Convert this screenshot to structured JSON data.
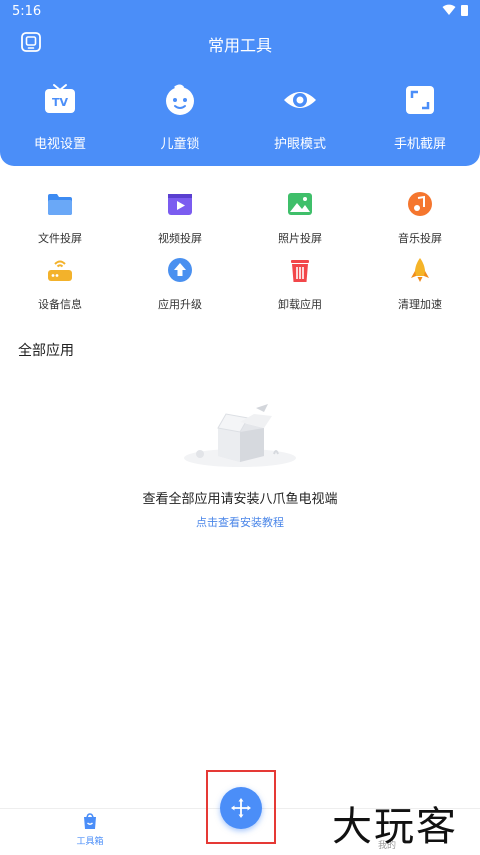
{
  "status_bar": {
    "time": "5:16"
  },
  "header": {
    "title": "常用工具",
    "cast_icon": "screen-cast-icon"
  },
  "quick_actions": [
    {
      "label": "电视设置",
      "icon": "tv-icon"
    },
    {
      "label": "儿童锁",
      "icon": "child-face-icon"
    },
    {
      "label": "护眼模式",
      "icon": "eye-icon"
    },
    {
      "label": "手机截屏",
      "icon": "screenshot-icon"
    }
  ],
  "tools": [
    {
      "label": "文件投屏",
      "icon": "folder-icon",
      "color": "#3d8bf2"
    },
    {
      "label": "视频投屏",
      "icon": "video-icon",
      "color": "#7b5cf0"
    },
    {
      "label": "照片投屏",
      "icon": "photo-icon",
      "color": "#3fbf6a"
    },
    {
      "label": "音乐投屏",
      "icon": "music-icon",
      "color": "#f5762e"
    },
    {
      "label": "设备信息",
      "icon": "router-icon",
      "color": "#f3b22b"
    },
    {
      "label": "应用升级",
      "icon": "upgrade-icon",
      "color": "#4a90f0"
    },
    {
      "label": "卸载应用",
      "icon": "trash-icon",
      "color": "#f2474a"
    },
    {
      "label": "清理加速",
      "icon": "rocket-icon",
      "color": "#f5b428"
    }
  ],
  "section": {
    "title": "全部应用"
  },
  "empty_state": {
    "icon": "empty-box-icon",
    "message": "查看全部应用请安装八爪鱼电视端",
    "link": "点击查看安装教程"
  },
  "bottom_nav": {
    "toolbox_label": "工具箱",
    "partial_label": "我的"
  },
  "fab": {
    "icon": "move-arrows-icon"
  },
  "watermark": {
    "text": "大玩客"
  },
  "colors": {
    "accent": "#4b8ef8",
    "highlight": "#e53935"
  }
}
